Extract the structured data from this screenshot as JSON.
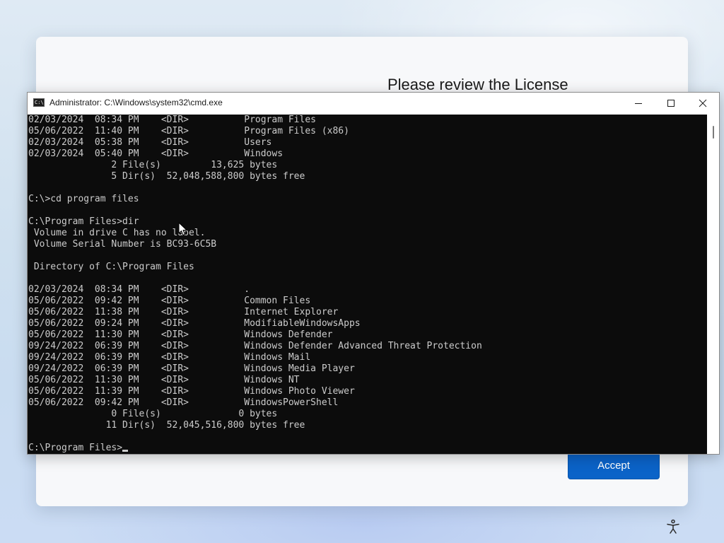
{
  "setup": {
    "title": "Please review the License",
    "accept_label": "Accept",
    "accessibility_icon": "accessibility-icon"
  },
  "cmd": {
    "title": "Administrator: C:\\Windows\\system32\\cmd.exe",
    "app_icon": "cmd-icon",
    "controls": {
      "minimize_icon": "minimize-icon",
      "maximize_icon": "maximize-icon",
      "close_icon": "close-icon"
    },
    "lines": [
      "02/03/2024  08:34 PM    <DIR>          Program Files",
      "05/06/2022  11:40 PM    <DIR>          Program Files (x86)",
      "02/03/2024  05:38 PM    <DIR>          Users",
      "02/03/2024  05:40 PM    <DIR>          Windows",
      "               2 File(s)         13,625 bytes",
      "               5 Dir(s)  52,048,588,800 bytes free",
      "",
      "C:\\>cd program files",
      "",
      "C:\\Program Files>dir",
      " Volume in drive C has no label.",
      " Volume Serial Number is BC93-6C5B",
      "",
      " Directory of C:\\Program Files",
      "",
      "02/03/2024  08:34 PM    <DIR>          .",
      "05/06/2022  09:42 PM    <DIR>          Common Files",
      "05/06/2022  11:38 PM    <DIR>          Internet Explorer",
      "05/06/2022  09:24 PM    <DIR>          ModifiableWindowsApps",
      "05/06/2022  11:30 PM    <DIR>          Windows Defender",
      "09/24/2022  06:39 PM    <DIR>          Windows Defender Advanced Threat Protection",
      "09/24/2022  06:39 PM    <DIR>          Windows Mail",
      "09/24/2022  06:39 PM    <DIR>          Windows Media Player",
      "05/06/2022  11:30 PM    <DIR>          Windows NT",
      "05/06/2022  11:39 PM    <DIR>          Windows Photo Viewer",
      "05/06/2022  09:42 PM    <DIR>          WindowsPowerShell",
      "               0 File(s)              0 bytes",
      "              11 Dir(s)  52,045,516,800 bytes free",
      ""
    ],
    "prompt": "C:\\Program Files>",
    "colors": {
      "console_bg": "#0c0c0c",
      "console_fg": "#cccccc"
    }
  },
  "accent_color": "#0b63c8"
}
